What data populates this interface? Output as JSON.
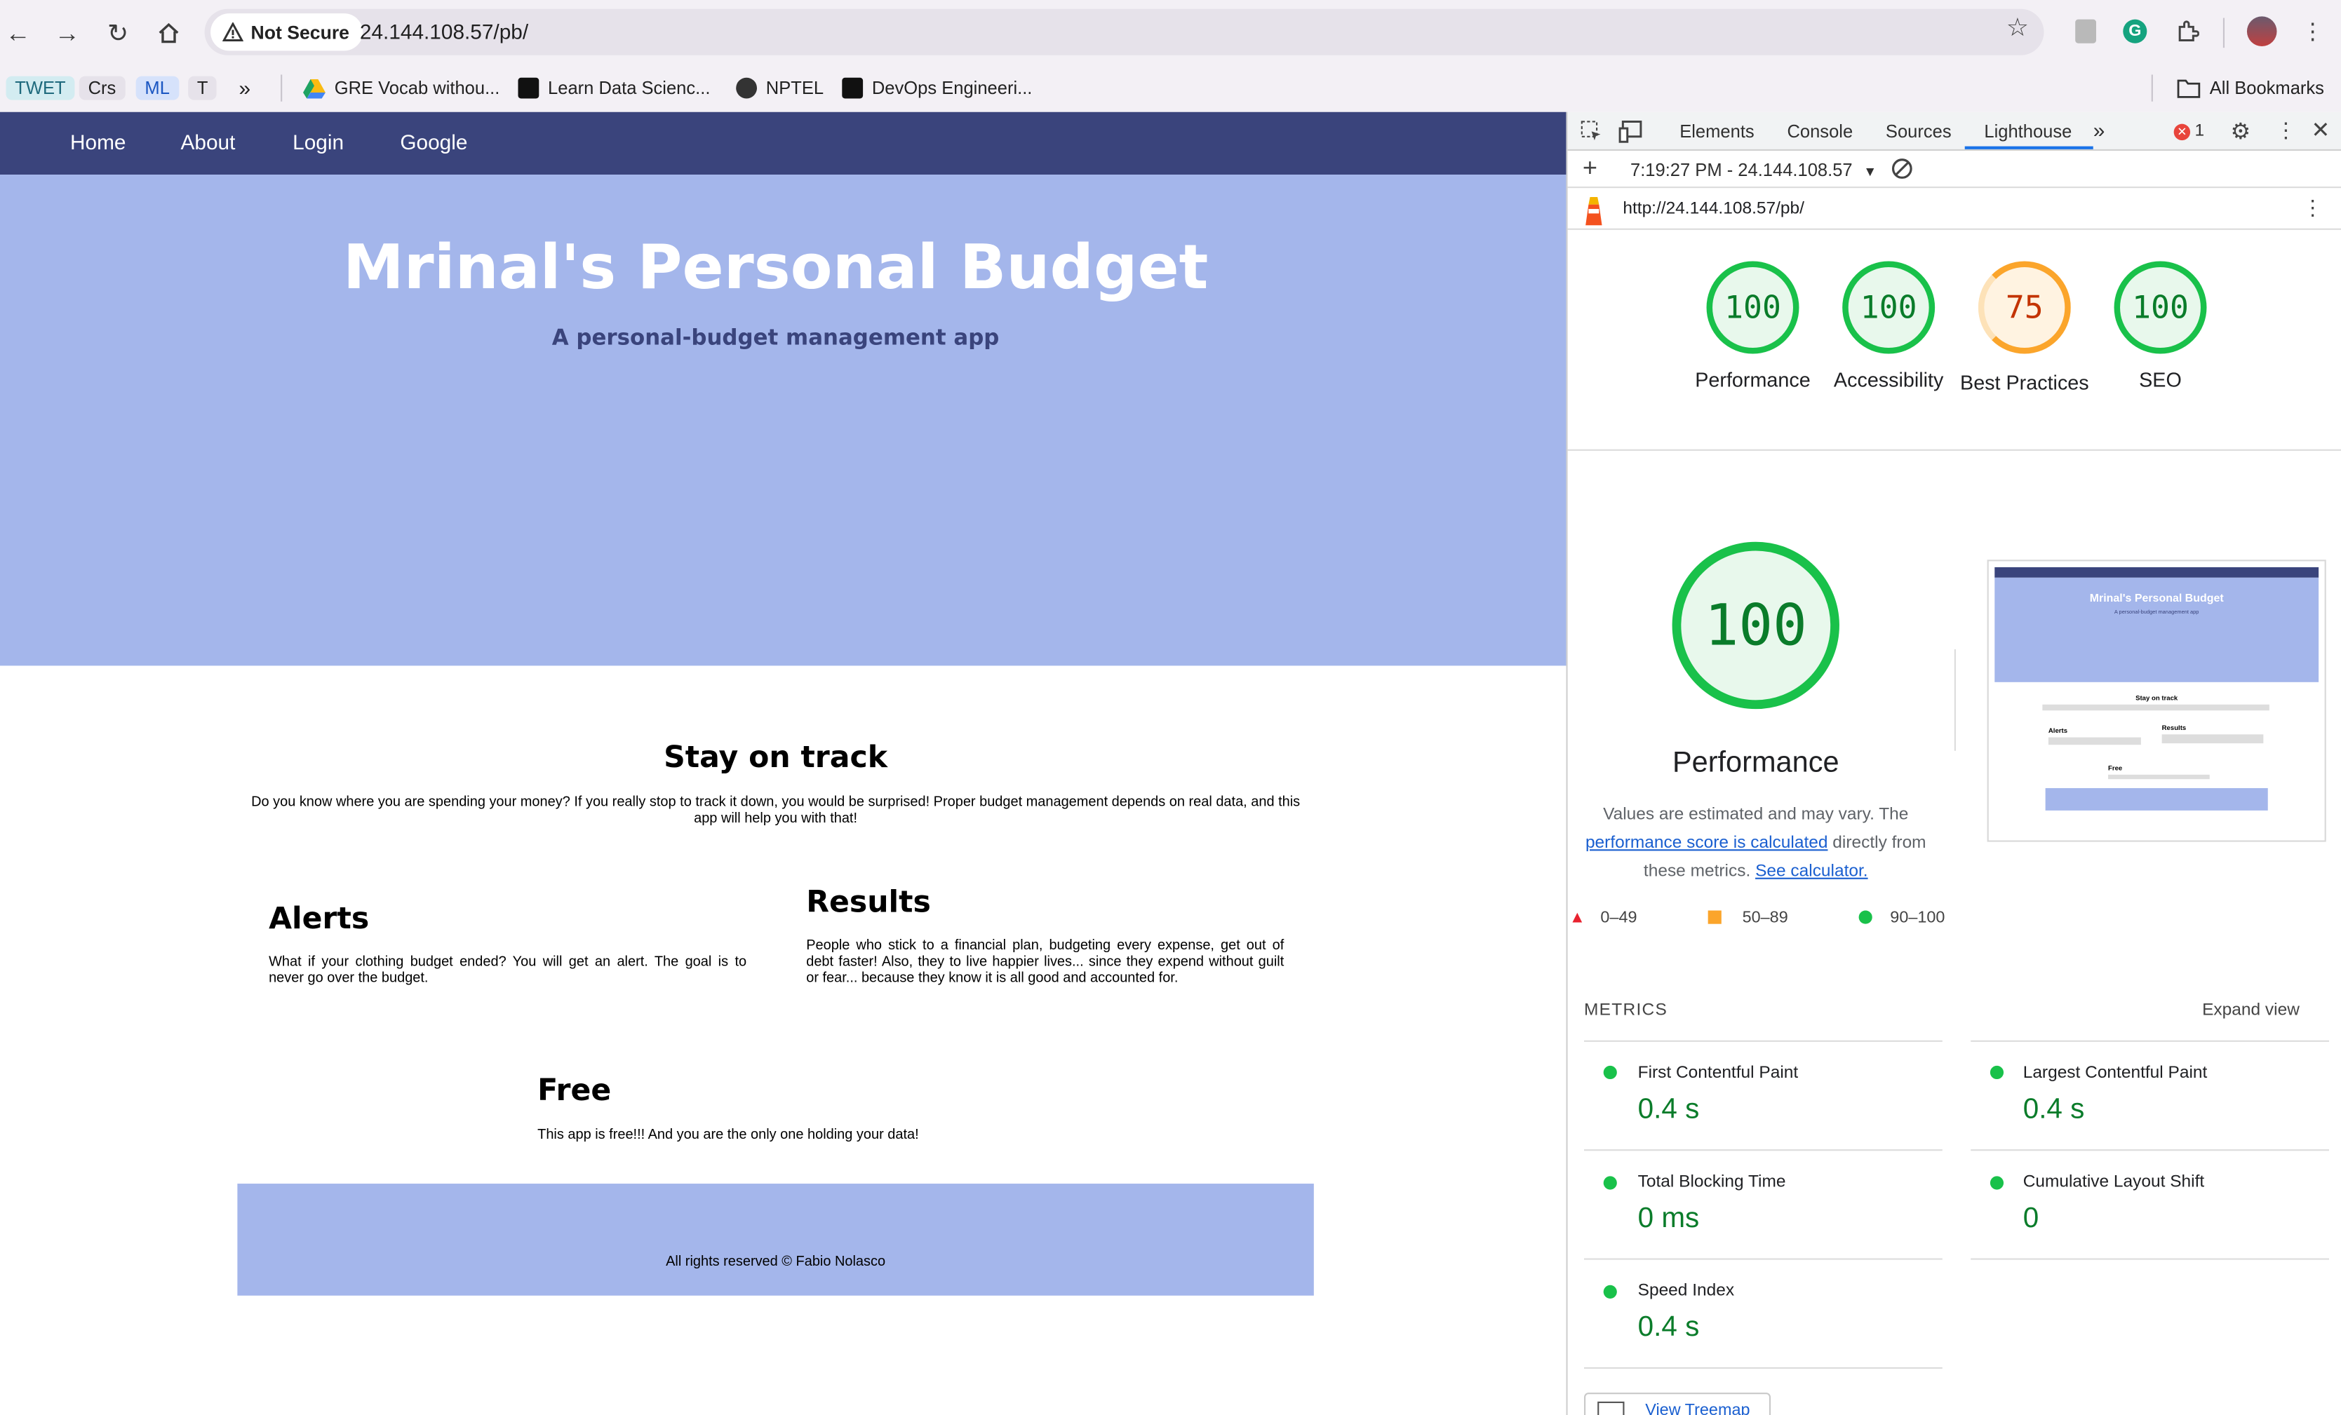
{
  "browser": {
    "security_label": "Not Secure",
    "url": "24.144.108.57/pb/",
    "bookmarks": [
      {
        "label": "TWET"
      },
      {
        "label": "Crs"
      },
      {
        "label": "ML"
      },
      {
        "label": "T"
      },
      {
        "label": "GRE Vocab withou..."
      },
      {
        "label": "Learn Data Scienc..."
      },
      {
        "label": "NPTEL"
      },
      {
        "label": "DevOps Engineeri..."
      }
    ],
    "all_bookmarks": "All Bookmarks"
  },
  "site": {
    "menu": [
      "Home",
      "About",
      "Login",
      "Google"
    ],
    "hero_title": "Mrinal's Personal Budget",
    "hero_subtitle": "A personal-budget management app",
    "stay_title": "Stay on track",
    "stay_text": "Do you know where you are spending your money? If you really stop to track it down, you would be surprised! Proper budget management depends on real data, and this app will help you with that!",
    "alerts_title": "Alerts",
    "alerts_text": "What if your clothing budget ended? You will get an alert. The goal is to never go over the budget.",
    "results_title": "Results",
    "results_text": "People who stick to a financial plan, budgeting every expense, get out of debt faster! Also, they to live happier lives... since they expend without guilt or fear... because they know it is all good and accounted for.",
    "free_title": "Free",
    "free_text": "This app is free!!! And you are the only one holding your data!",
    "footer": "All rights reserved © Fabio Nolasco"
  },
  "devtools": {
    "tabs": [
      "Elements",
      "Console",
      "Sources",
      "Lighthouse"
    ],
    "error_count": "1",
    "report_time": "7:19:27 PM - 24.144.108.57",
    "report_url": "http://24.144.108.57/pb/",
    "scores": [
      {
        "value": "100",
        "label": "Performance"
      },
      {
        "value": "100",
        "label": "Accessibility"
      },
      {
        "value": "75",
        "label": "Best Practices"
      },
      {
        "value": "100",
        "label": "SEO"
      }
    ],
    "perf_big": "100",
    "perf_title": "Performance",
    "perf_note_1": "Values are estimated and may vary. The",
    "perf_link": "performance score is calculated",
    "perf_note_2": "directly from",
    "perf_note_3": "these metrics.",
    "perf_calc": "See calculator.",
    "legend": [
      "0–49",
      "50–89",
      "90–100"
    ],
    "metrics_title": "METRICS",
    "expand": "Expand view",
    "metrics": [
      {
        "name": "First Contentful Paint",
        "value": "0.4 s"
      },
      {
        "name": "Largest Contentful Paint",
        "value": "0.4 s"
      },
      {
        "name": "Total Blocking Time",
        "value": "0 ms"
      },
      {
        "name": "Cumulative Layout Shift",
        "value": "0"
      },
      {
        "name": "Speed Index",
        "value": "0.4 s"
      }
    ],
    "view_treemap": "View Treemap",
    "thumb": {
      "title": "Mrinal's Personal Budget",
      "subtitle": "A personal-budget management app",
      "stay": "Stay on track",
      "alerts": "Alerts",
      "results": "Results",
      "free": "Free"
    }
  }
}
